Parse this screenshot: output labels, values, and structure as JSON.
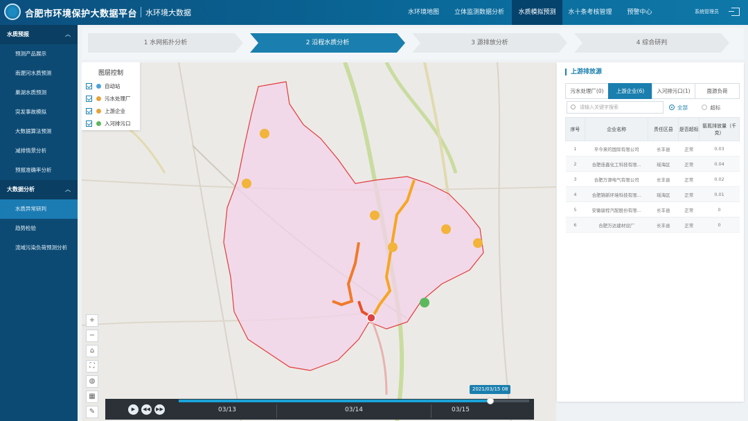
{
  "header": {
    "app_title": "合肥市环境保护大数据平台",
    "sub_title": "水环境大数据",
    "nav": [
      "水环境地图",
      "立体监测数据分析",
      "水质模拟预测",
      "水十条考核管理",
      "预警中心"
    ],
    "active_nav": "水质模拟预测",
    "user": "系统管理员"
  },
  "sidebar": {
    "groups": [
      {
        "label": "水质预报",
        "items": [
          "预测产品展示",
          "南淝河水质预测",
          "巢湖水质预测",
          "突发事故模拟",
          "大数据算法预测",
          "减排情景分析",
          "预报准确率分析"
        ]
      },
      {
        "label": "大数据分析",
        "items": [
          "水质异常研判",
          "趋势检验",
          "流域污染负荷预测分析"
        ]
      }
    ],
    "active_item": "水质异常研判"
  },
  "steps": [
    "1 水网拓扑分析",
    "2 沿程水质分析",
    "3 源排放分析",
    "4 综合研判"
  ],
  "active_step": "2 沿程水质分析",
  "layer_control": {
    "title": "图层控制",
    "layers": [
      {
        "label": "自动站",
        "color": "#4aa3d8"
      },
      {
        "label": "污水处理厂",
        "color": "#e8a23a"
      },
      {
        "label": "上游企业",
        "color": "#e8a23a"
      },
      {
        "label": "入河排污口",
        "color": "#5cb85c"
      }
    ]
  },
  "timeline": {
    "tooltip": "2021/03/15 08",
    "labels": [
      "03/13",
      "03/14",
      "03/15"
    ],
    "progress": 0.89
  },
  "panel": {
    "title": "上游排放源",
    "tabs": [
      "污水处理厂(0)",
      "上游企业(6)",
      "入河排污口(1)",
      "面源负荷"
    ],
    "active_tab": "上游企业(6)",
    "search_placeholder": "请输入关键字搜索",
    "filters": [
      "全部",
      "超标"
    ],
    "columns": [
      "序号",
      "企业名称",
      "责任区县",
      "是否超标",
      "氨氮排放量（千克）"
    ],
    "rows": [
      [
        "1",
        "平今来的国际有限公司",
        "长丰县",
        "正常",
        "0.03"
      ],
      [
        "2",
        "合肥佳鑫化工科技有限...",
        "瑶海区",
        "正常",
        "0.04"
      ],
      [
        "3",
        "合肥万源电气有限公司",
        "长丰县",
        "正常",
        "0.02"
      ],
      [
        "4",
        "合肥锦新环境科技有限...",
        "瑶海区",
        "正常",
        "0.01"
      ],
      [
        "5",
        "安徽骏程汽配股份有限...",
        "长丰县",
        "正常",
        "0"
      ],
      [
        "6",
        "合肥万达建材设厂",
        "长丰县",
        "正常",
        "0"
      ]
    ]
  }
}
